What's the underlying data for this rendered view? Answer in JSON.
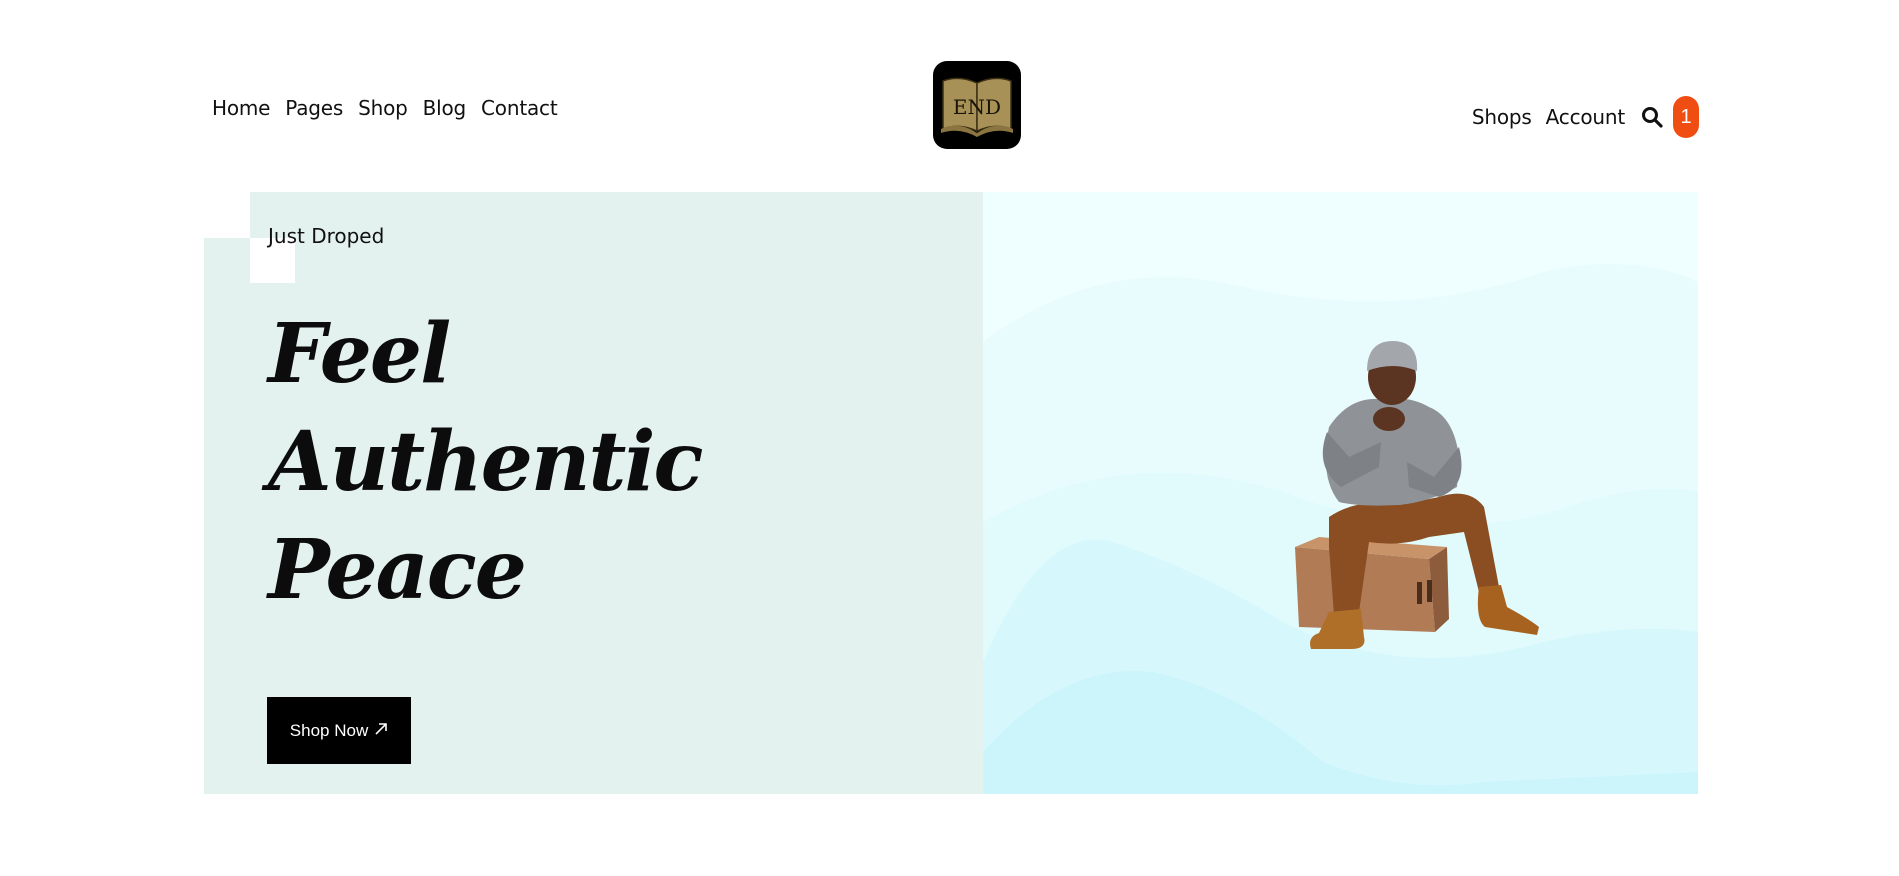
{
  "header": {
    "nav_left": [
      "Home",
      "Pages",
      "Shop",
      "Blog",
      "Contact"
    ],
    "logo_text": "END",
    "nav_right": [
      "Shops",
      "Account"
    ],
    "cart_count": "1",
    "accent_color": "#f04d12"
  },
  "hero": {
    "eyebrow": "Just Droped",
    "title_lines": [
      "Feel",
      "Authentic",
      "Peace"
    ],
    "button_label": "Shop Now",
    "button_icon": "arrow-up-right-icon",
    "left_bg": "#e3f2ef",
    "right_bg": "#effefe"
  }
}
